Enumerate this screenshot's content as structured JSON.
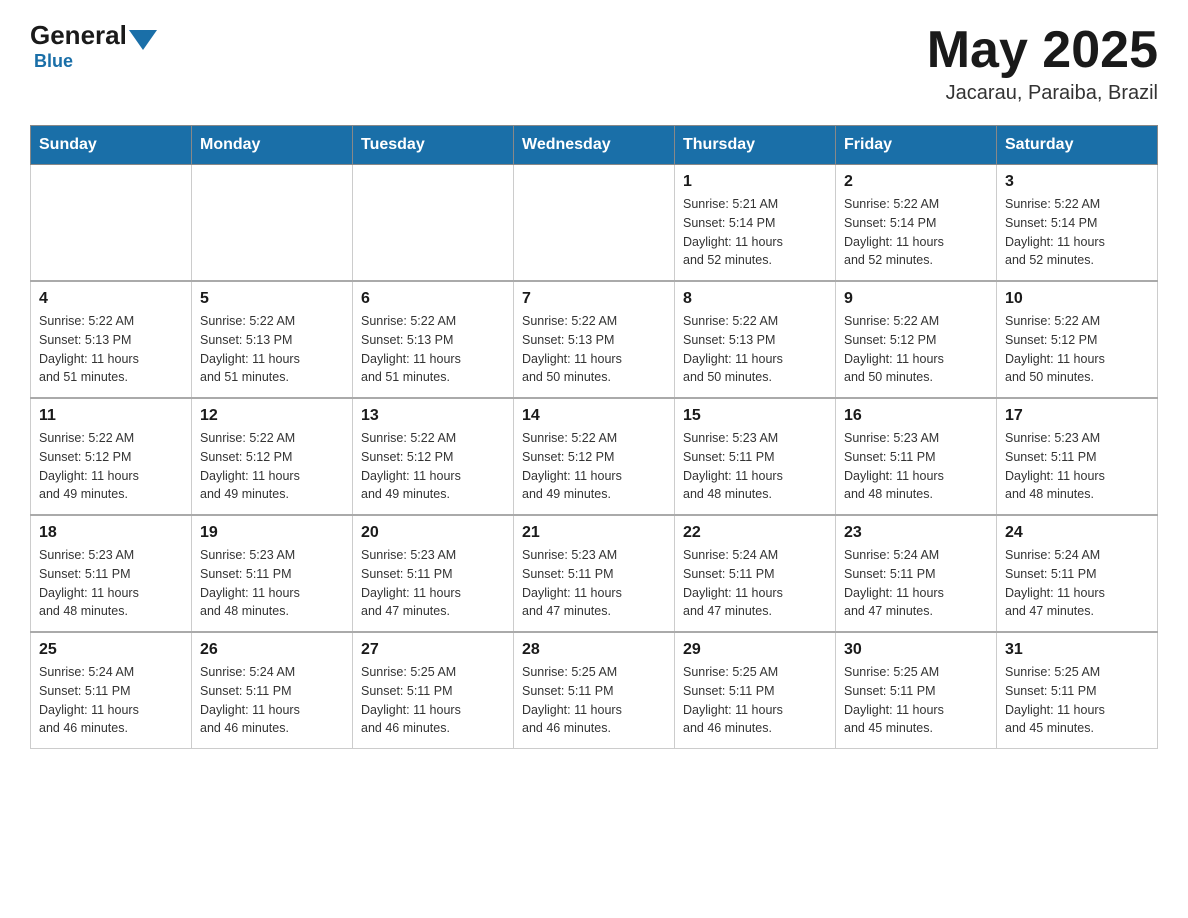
{
  "header": {
    "logo_general": "General",
    "logo_blue": "Blue",
    "month_title": "May 2025",
    "location": "Jacarau, Paraiba, Brazil"
  },
  "calendar": {
    "days_of_week": [
      "Sunday",
      "Monday",
      "Tuesday",
      "Wednesday",
      "Thursday",
      "Friday",
      "Saturday"
    ],
    "rows": [
      [
        {
          "day": "",
          "info": ""
        },
        {
          "day": "",
          "info": ""
        },
        {
          "day": "",
          "info": ""
        },
        {
          "day": "",
          "info": ""
        },
        {
          "day": "1",
          "info": "Sunrise: 5:21 AM\nSunset: 5:14 PM\nDaylight: 11 hours\nand 52 minutes."
        },
        {
          "day": "2",
          "info": "Sunrise: 5:22 AM\nSunset: 5:14 PM\nDaylight: 11 hours\nand 52 minutes."
        },
        {
          "day": "3",
          "info": "Sunrise: 5:22 AM\nSunset: 5:14 PM\nDaylight: 11 hours\nand 52 minutes."
        }
      ],
      [
        {
          "day": "4",
          "info": "Sunrise: 5:22 AM\nSunset: 5:13 PM\nDaylight: 11 hours\nand 51 minutes."
        },
        {
          "day": "5",
          "info": "Sunrise: 5:22 AM\nSunset: 5:13 PM\nDaylight: 11 hours\nand 51 minutes."
        },
        {
          "day": "6",
          "info": "Sunrise: 5:22 AM\nSunset: 5:13 PM\nDaylight: 11 hours\nand 51 minutes."
        },
        {
          "day": "7",
          "info": "Sunrise: 5:22 AM\nSunset: 5:13 PM\nDaylight: 11 hours\nand 50 minutes."
        },
        {
          "day": "8",
          "info": "Sunrise: 5:22 AM\nSunset: 5:13 PM\nDaylight: 11 hours\nand 50 minutes."
        },
        {
          "day": "9",
          "info": "Sunrise: 5:22 AM\nSunset: 5:12 PM\nDaylight: 11 hours\nand 50 minutes."
        },
        {
          "day": "10",
          "info": "Sunrise: 5:22 AM\nSunset: 5:12 PM\nDaylight: 11 hours\nand 50 minutes."
        }
      ],
      [
        {
          "day": "11",
          "info": "Sunrise: 5:22 AM\nSunset: 5:12 PM\nDaylight: 11 hours\nand 49 minutes."
        },
        {
          "day": "12",
          "info": "Sunrise: 5:22 AM\nSunset: 5:12 PM\nDaylight: 11 hours\nand 49 minutes."
        },
        {
          "day": "13",
          "info": "Sunrise: 5:22 AM\nSunset: 5:12 PM\nDaylight: 11 hours\nand 49 minutes."
        },
        {
          "day": "14",
          "info": "Sunrise: 5:22 AM\nSunset: 5:12 PM\nDaylight: 11 hours\nand 49 minutes."
        },
        {
          "day": "15",
          "info": "Sunrise: 5:23 AM\nSunset: 5:11 PM\nDaylight: 11 hours\nand 48 minutes."
        },
        {
          "day": "16",
          "info": "Sunrise: 5:23 AM\nSunset: 5:11 PM\nDaylight: 11 hours\nand 48 minutes."
        },
        {
          "day": "17",
          "info": "Sunrise: 5:23 AM\nSunset: 5:11 PM\nDaylight: 11 hours\nand 48 minutes."
        }
      ],
      [
        {
          "day": "18",
          "info": "Sunrise: 5:23 AM\nSunset: 5:11 PM\nDaylight: 11 hours\nand 48 minutes."
        },
        {
          "day": "19",
          "info": "Sunrise: 5:23 AM\nSunset: 5:11 PM\nDaylight: 11 hours\nand 48 minutes."
        },
        {
          "day": "20",
          "info": "Sunrise: 5:23 AM\nSunset: 5:11 PM\nDaylight: 11 hours\nand 47 minutes."
        },
        {
          "day": "21",
          "info": "Sunrise: 5:23 AM\nSunset: 5:11 PM\nDaylight: 11 hours\nand 47 minutes."
        },
        {
          "day": "22",
          "info": "Sunrise: 5:24 AM\nSunset: 5:11 PM\nDaylight: 11 hours\nand 47 minutes."
        },
        {
          "day": "23",
          "info": "Sunrise: 5:24 AM\nSunset: 5:11 PM\nDaylight: 11 hours\nand 47 minutes."
        },
        {
          "day": "24",
          "info": "Sunrise: 5:24 AM\nSunset: 5:11 PM\nDaylight: 11 hours\nand 47 minutes."
        }
      ],
      [
        {
          "day": "25",
          "info": "Sunrise: 5:24 AM\nSunset: 5:11 PM\nDaylight: 11 hours\nand 46 minutes."
        },
        {
          "day": "26",
          "info": "Sunrise: 5:24 AM\nSunset: 5:11 PM\nDaylight: 11 hours\nand 46 minutes."
        },
        {
          "day": "27",
          "info": "Sunrise: 5:25 AM\nSunset: 5:11 PM\nDaylight: 11 hours\nand 46 minutes."
        },
        {
          "day": "28",
          "info": "Sunrise: 5:25 AM\nSunset: 5:11 PM\nDaylight: 11 hours\nand 46 minutes."
        },
        {
          "day": "29",
          "info": "Sunrise: 5:25 AM\nSunset: 5:11 PM\nDaylight: 11 hours\nand 46 minutes."
        },
        {
          "day": "30",
          "info": "Sunrise: 5:25 AM\nSunset: 5:11 PM\nDaylight: 11 hours\nand 45 minutes."
        },
        {
          "day": "31",
          "info": "Sunrise: 5:25 AM\nSunset: 5:11 PM\nDaylight: 11 hours\nand 45 minutes."
        }
      ]
    ]
  }
}
